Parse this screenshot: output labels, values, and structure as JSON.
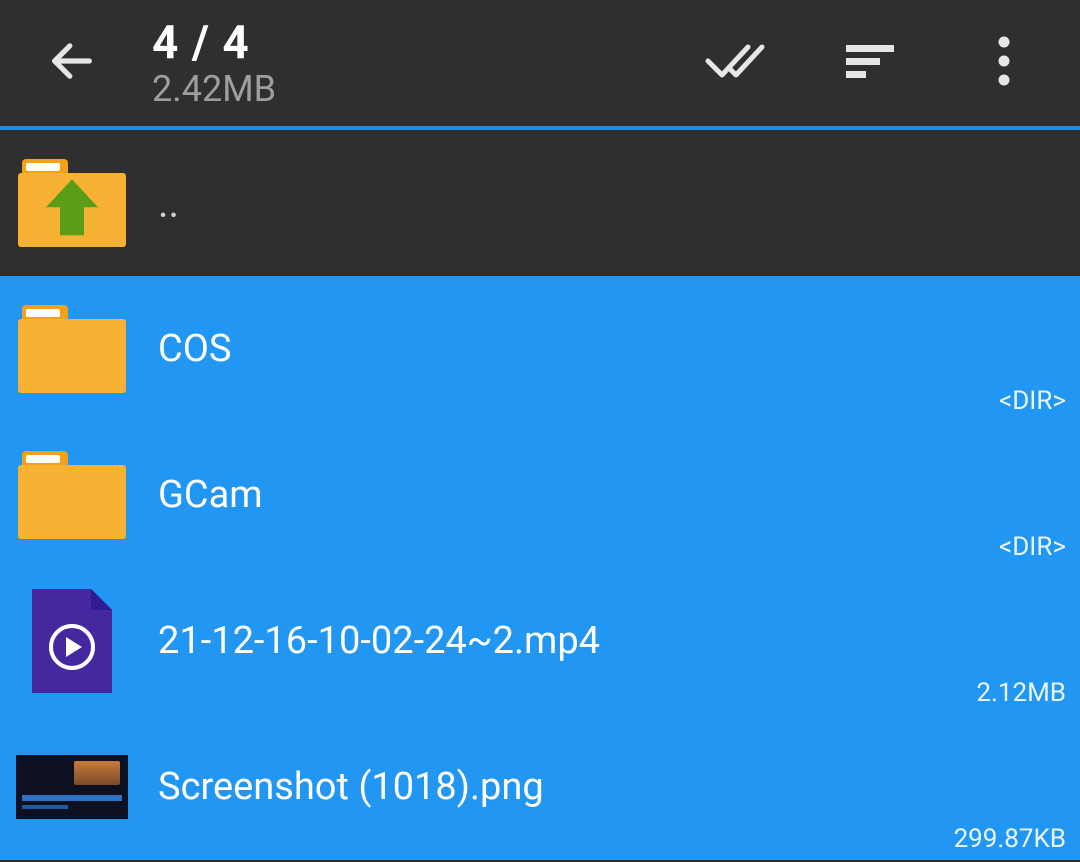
{
  "header": {
    "count_label": "4 / 4",
    "size_label": "2.42MB"
  },
  "rows": {
    "up": {
      "name": ".."
    },
    "cos": {
      "name": "COS",
      "meta": "<DIR>"
    },
    "gcam": {
      "name": "GCam",
      "meta": "<DIR>"
    },
    "mp4": {
      "name": "21-12-16-10-02-24~2.mp4",
      "meta": "2.12MB"
    },
    "png": {
      "name": "Screenshot (1018).png",
      "meta": "299.87KB"
    }
  }
}
